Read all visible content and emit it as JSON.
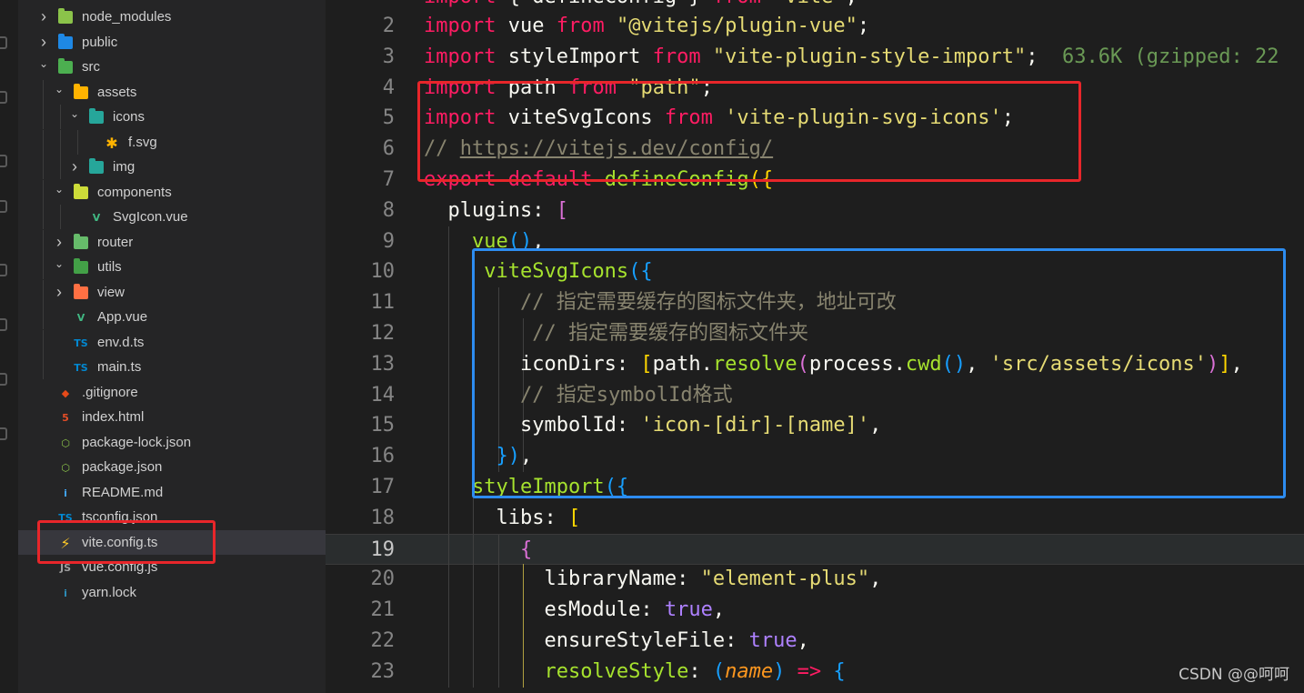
{
  "explorer": {
    "items": [
      {
        "label": "node_modules",
        "icon": "folder-node-icon",
        "expanded": false
      },
      {
        "label": "public",
        "icon": "folder-public-icon",
        "expanded": false
      },
      {
        "label": "src",
        "icon": "folder-src-icon",
        "expanded": true
      },
      {
        "label": "assets",
        "icon": "folder-assets-icon",
        "expanded": true
      },
      {
        "label": "icons",
        "icon": "folder-icons-icon",
        "expanded": true
      },
      {
        "label": "f.svg",
        "icon": "svg-file-icon"
      },
      {
        "label": "img",
        "icon": "folder-images-icon",
        "expanded": false
      },
      {
        "label": "components",
        "icon": "folder-components-icon",
        "expanded": true
      },
      {
        "label": "SvgIcon.vue",
        "icon": "vue-file-icon"
      },
      {
        "label": "router",
        "icon": "folder-router-icon",
        "expanded": false
      },
      {
        "label": "utils",
        "icon": "folder-utils-icon",
        "expanded": true
      },
      {
        "label": "view",
        "icon": "folder-view-icon",
        "expanded": false
      },
      {
        "label": "App.vue",
        "icon": "vue-file-icon"
      },
      {
        "label": "env.d.ts",
        "icon": "typescript-file-icon"
      },
      {
        "label": "main.ts",
        "icon": "typescript-file-icon"
      },
      {
        "label": ".gitignore",
        "icon": "git-file-icon"
      },
      {
        "label": "index.html",
        "icon": "html-file-icon"
      },
      {
        "label": "package-lock.json",
        "icon": "nodejs-file-icon"
      },
      {
        "label": "package.json",
        "icon": "nodejs-file-icon"
      },
      {
        "label": "README.md",
        "icon": "info-file-icon"
      },
      {
        "label": "tsconfig.json",
        "icon": "tsconfig-file-icon"
      },
      {
        "label": "vite.config.ts",
        "icon": "vite-file-icon",
        "selected": true
      },
      {
        "label": "vue.config.js",
        "icon": "js-file-icon"
      },
      {
        "label": "yarn.lock",
        "icon": "yarn-file-icon"
      }
    ],
    "icon_letters": {
      "ts": "TS",
      "html": "5",
      "node": "⬡",
      "info": "i",
      "js": "JS",
      "svg": "✱",
      "vue": "V",
      "git": "◆",
      "vite": "⚡"
    }
  },
  "editor": {
    "lines": [
      {
        "n": "2",
        "tokens": [
          [
            "kw",
            "import"
          ],
          [
            "id",
            " vue "
          ],
          [
            "kw",
            "from"
          ],
          [
            "id",
            " "
          ],
          [
            "str",
            "\"@vitejs/plugin-vue\""
          ],
          [
            "id",
            ";"
          ]
        ]
      },
      {
        "n": "3",
        "tokens": [
          [
            "kw",
            "import"
          ],
          [
            "id",
            " styleImport "
          ],
          [
            "kw",
            "from"
          ],
          [
            "id",
            " "
          ],
          [
            "str",
            "\"vite-plugin-style-import\""
          ],
          [
            "id",
            ";  "
          ],
          [
            "size",
            "63.6K (gzipped: 22"
          ]
        ]
      },
      {
        "n": "4",
        "tokens": [
          [
            "kw",
            "import"
          ],
          [
            "id",
            " path "
          ],
          [
            "kw",
            "from"
          ],
          [
            "id",
            " "
          ],
          [
            "str",
            "\"path\""
          ],
          [
            "id",
            ";"
          ]
        ]
      },
      {
        "n": "5",
        "tokens": [
          [
            "kw",
            "import"
          ],
          [
            "id",
            " viteSvgIcons "
          ],
          [
            "kw",
            "from"
          ],
          [
            "id",
            " "
          ],
          [
            "str",
            "'vite-plugin-svg-icons'"
          ],
          [
            "id",
            ";"
          ]
        ]
      },
      {
        "n": "6",
        "tokens": [
          [
            "cmt",
            "// "
          ],
          [
            "url",
            "https://vitejs.dev/config/"
          ]
        ]
      },
      {
        "n": "7",
        "tokens": [
          [
            "kw",
            "export"
          ],
          [
            "id",
            " "
          ],
          [
            "kw",
            "default"
          ],
          [
            "id",
            " "
          ],
          [
            "fn",
            "defineConfig"
          ],
          [
            "b1",
            "({"
          ]
        ]
      },
      {
        "n": "8",
        "tokens": [
          [
            "id",
            "  plugins: "
          ],
          [
            "b2",
            "["
          ]
        ]
      },
      {
        "n": "9",
        "tokens": [
          [
            "id",
            "    "
          ],
          [
            "fn",
            "vue"
          ],
          [
            "b3",
            "()"
          ],
          [
            "id",
            ","
          ]
        ]
      },
      {
        "n": "10",
        "tokens": [
          [
            "id",
            "     "
          ],
          [
            "fn",
            "viteSvgIcons"
          ],
          [
            "b3",
            "({"
          ]
        ]
      },
      {
        "n": "11",
        "tokens": [
          [
            "id",
            "        "
          ],
          [
            "cmt",
            "// 指定需要缓存的图标文件夹，地址可改"
          ]
        ]
      },
      {
        "n": "12",
        "tokens": [
          [
            "id",
            "         "
          ],
          [
            "cmt",
            "// 指定需要缓存的图标文件夹"
          ]
        ]
      },
      {
        "n": "13",
        "tokens": [
          [
            "id",
            "        iconDirs: "
          ],
          [
            "b1",
            "["
          ],
          [
            "id",
            "path."
          ],
          [
            "fn",
            "resolve"
          ],
          [
            "b2",
            "("
          ],
          [
            "id",
            "process."
          ],
          [
            "fn",
            "cwd"
          ],
          [
            "b3",
            "()"
          ],
          [
            "id",
            ", "
          ],
          [
            "str",
            "'src/assets/icons'"
          ],
          [
            "b2",
            ")"
          ],
          [
            "b1",
            "]"
          ],
          [
            "id",
            ","
          ]
        ]
      },
      {
        "n": "14",
        "tokens": [
          [
            "id",
            "        "
          ],
          [
            "cmt",
            "// 指定symbolId格式"
          ]
        ]
      },
      {
        "n": "15",
        "tokens": [
          [
            "id",
            "        symbolId: "
          ],
          [
            "str",
            "'icon-[dir]-[name]'"
          ],
          [
            "id",
            ","
          ]
        ]
      },
      {
        "n": "16",
        "tokens": [
          [
            "id",
            "      "
          ],
          [
            "b3",
            "})"
          ],
          [
            "id",
            ","
          ]
        ]
      },
      {
        "n": "17",
        "tokens": [
          [
            "id",
            "    "
          ],
          [
            "fn",
            "styleImport"
          ],
          [
            "b3",
            "({"
          ]
        ]
      },
      {
        "n": "18",
        "tokens": [
          [
            "id",
            "      libs: "
          ],
          [
            "b1",
            "["
          ]
        ]
      },
      {
        "n": "19",
        "tokens": [
          [
            "id",
            "        "
          ],
          [
            "b2",
            "{"
          ]
        ]
      },
      {
        "n": "20",
        "tokens": [
          [
            "id",
            "          libraryName: "
          ],
          [
            "str",
            "\"element-plus\""
          ],
          [
            "id",
            ","
          ]
        ]
      },
      {
        "n": "21",
        "tokens": [
          [
            "id",
            "          esModule: "
          ],
          [
            "bool",
            "true"
          ],
          [
            "id",
            ","
          ]
        ]
      },
      {
        "n": "22",
        "tokens": [
          [
            "id",
            "          ensureStyleFile: "
          ],
          [
            "bool",
            "true"
          ],
          [
            "id",
            ","
          ]
        ]
      },
      {
        "n": "23",
        "tokens": [
          [
            "id",
            "          "
          ],
          [
            "fn",
            "resolveStyle"
          ],
          [
            "id",
            ": "
          ],
          [
            "b3",
            "("
          ],
          [
            "param",
            "name"
          ],
          [
            "b3",
            ")"
          ],
          [
            "id",
            " "
          ],
          [
            "arrow",
            "=>"
          ],
          [
            "id",
            " "
          ],
          [
            "b3",
            "{"
          ]
        ]
      }
    ],
    "top_partial": {
      "tokens": [
        [
          "kw",
          "import"
        ],
        [
          "id",
          " { defineConfig } "
        ],
        [
          "kw",
          "from"
        ],
        [
          "id",
          " "
        ],
        [
          "str",
          "\"vite\""
        ],
        [
          "id",
          ";"
        ]
      ]
    },
    "current_line": "19"
  },
  "watermark": "CSDN @@呵呵"
}
